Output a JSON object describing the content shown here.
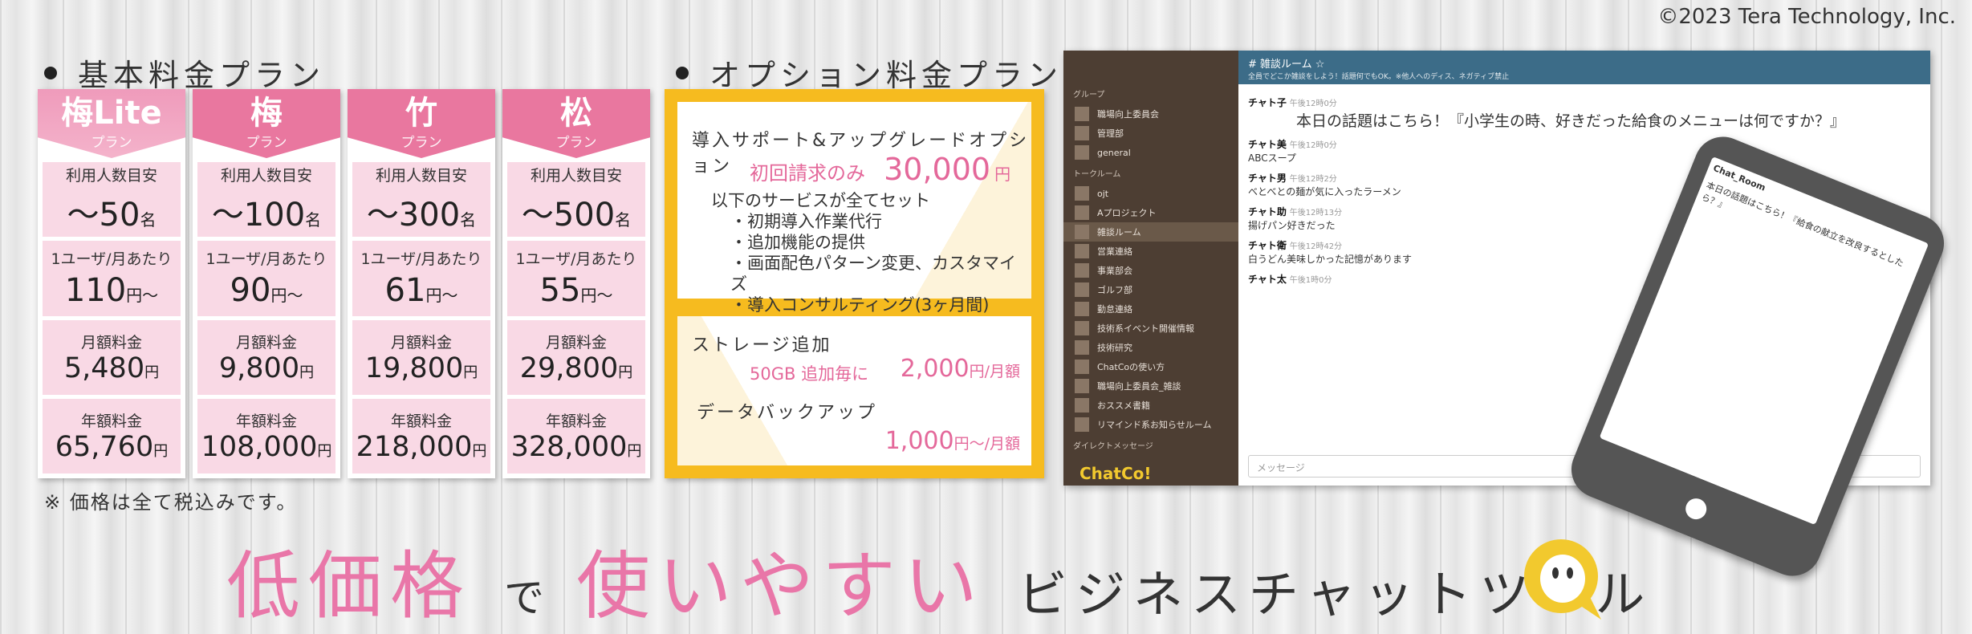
{
  "copyright": "©2023 Tera Technology, Inc.",
  "basic_title": "基本料金プラン",
  "option_title": "オプション料金プラン",
  "plans": [
    {
      "name": "梅Lite",
      "sub": "プラン",
      "users_label": "利用人数目安",
      "users": "～50",
      "users_unit": "名",
      "unit_label": "1ユーザ/月あたり",
      "unit_price": "110",
      "unit_suffix": "円〜",
      "monthly_label": "月額料金",
      "monthly": "5,480",
      "monthly_unit": "円",
      "yearly_label": "年額料金",
      "yearly": "65,760",
      "yearly_unit": "円"
    },
    {
      "name": "梅",
      "sub": "プラン",
      "users_label": "利用人数目安",
      "users": "～100",
      "users_unit": "名",
      "unit_label": "1ユーザ/月あたり",
      "unit_price": "90",
      "unit_suffix": "円〜",
      "monthly_label": "月額料金",
      "monthly": "9,800",
      "monthly_unit": "円",
      "yearly_label": "年額料金",
      "yearly": "108,000",
      "yearly_unit": "円"
    },
    {
      "name": "竹",
      "sub": "プラン",
      "users_label": "利用人数目安",
      "users": "～300",
      "users_unit": "名",
      "unit_label": "1ユーザ/月あたり",
      "unit_price": "61",
      "unit_suffix": "円〜",
      "monthly_label": "月額料金",
      "monthly": "19,800",
      "monthly_unit": "円",
      "yearly_label": "年額料金",
      "yearly": "218,000",
      "yearly_unit": "円"
    },
    {
      "name": "松",
      "sub": "プラン",
      "users_label": "利用人数目安",
      "users": "～500",
      "users_unit": "名",
      "unit_label": "1ユーザ/月あたり",
      "unit_price": "55",
      "unit_suffix": "円〜",
      "monthly_label": "月額料金",
      "monthly": "29,800",
      "monthly_unit": "円",
      "yearly_label": "年額料金",
      "yearly": "328,000",
      "yearly_unit": "円"
    }
  ],
  "note": "※ 価格は全て税込みです。",
  "options": {
    "support_title": "導入サポート&アップグレードオプション",
    "support_price_label": "初回請求のみ",
    "support_price": "30,000",
    "support_unit": "円",
    "services_intro": "以下のサービスが全てセット",
    "services": [
      "・初期導入作業代行",
      "・追加機能の提供",
      "・画面配色パターン変更、カスタマイズ",
      "・導入コンサルティング(3ヶ月間)"
    ],
    "storage_title": "ストレージ追加",
    "storage_desc": "50GB 追加毎に",
    "storage_price": "2,000",
    "storage_unit": "円/月額",
    "backup_title": "データバックアップ",
    "backup_price": "1,000",
    "backup_unit": "円〜/月額"
  },
  "app": {
    "channel_title": "# 雑談ルーム ☆",
    "channel_desc": "全員でどこか雑談をしよう！話題何でもOK。※他人へのディス、ネガティブ禁止",
    "groups_label": "グループ",
    "groups": [
      "職場向上委員会",
      "管理部",
      "general"
    ],
    "talkroom_label": "トークルーム",
    "rooms": [
      "ojt",
      "Aプロジェクト",
      "雑談ルーム",
      "営業連絡",
      "事業部会",
      "ゴルフ部",
      "勤怠連絡",
      "技術系イベント開催情報",
      "技術研究",
      "ChatCoの使い方",
      "職場向上委員会_雑談",
      "おススメ書籍",
      "リマインド系お知らせルーム"
    ],
    "dm_label": "ダイレクトメッセージ",
    "logo": "ChatCo!",
    "messages": [
      {
        "user": "チャト子",
        "time": "午後12時0分",
        "text": "本日の話題はこちら！『小学生の時、好きだった給食のメニューは何ですか？』"
      },
      {
        "user": "チャト美",
        "time": "午後12時0分",
        "text": "ABCスープ"
      },
      {
        "user": "チャト男",
        "time": "午後12時2分",
        "text": "べとべとの麺が気に入ったラーメン"
      },
      {
        "user": "チャト助",
        "time": "午後12時13分",
        "text": "揚げパン好きだった"
      },
      {
        "user": "チャト衛",
        "time": "午後12時42分",
        "text": "白うどん美味しかった記憶があります"
      },
      {
        "user": "チャト太",
        "time": "午後1時0分",
        "text": ""
      }
    ],
    "input_placeholder": "メッセージ"
  },
  "phone": {
    "room": "Chat_Room",
    "msg": "本日の話題はこちら！『給食の献立を改良するとしたら？』"
  },
  "tagline": {
    "part1": "低価格",
    "part2": "で",
    "part3": "使いやすい",
    "part4": "ビジネスチャットツール"
  },
  "colors": {
    "pink": "#e976a8",
    "plan_head": "#e9779f",
    "option_border": "#f6bb1f",
    "sidebar": "#4d3e33",
    "topbar": "#3c6c88",
    "logo": "#f2c92e"
  }
}
